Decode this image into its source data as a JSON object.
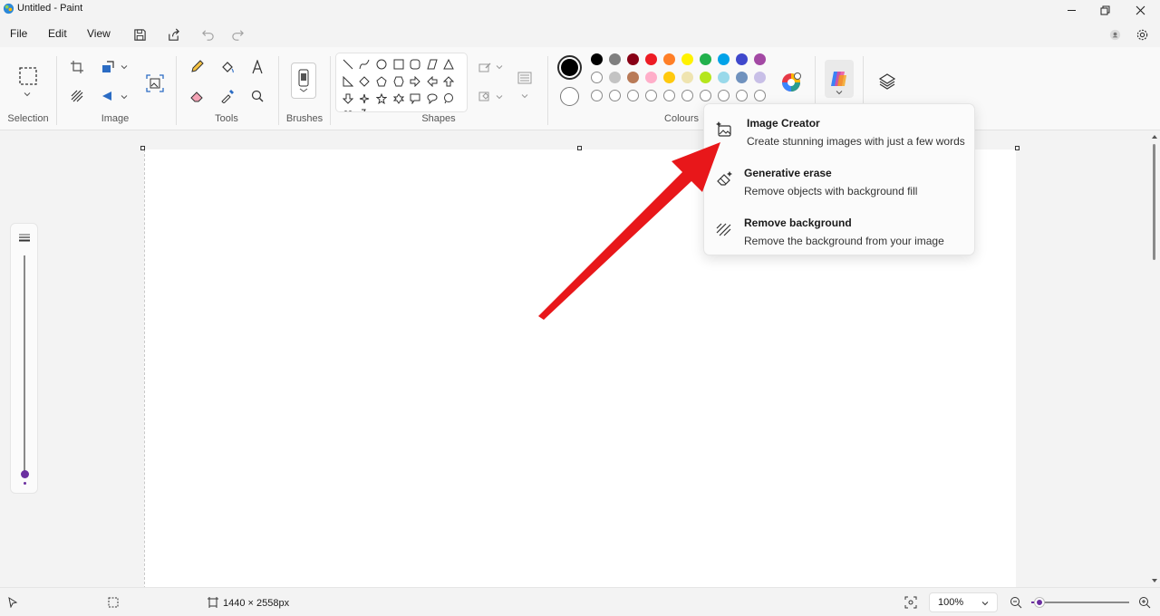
{
  "window": {
    "title": "Untitled - Paint"
  },
  "menu": {
    "file": "File",
    "edit": "Edit",
    "view": "View"
  },
  "ribbon": {
    "groups": {
      "selection": "Selection",
      "image": "Image",
      "tools": "Tools",
      "brushes": "Brushes",
      "shapes": "Shapes",
      "colours": "Colours"
    }
  },
  "palette": {
    "primary": "#000000",
    "secondary": "#ffffff",
    "row1": [
      "#000000",
      "#7f7f7f",
      "#880015",
      "#ed1c24",
      "#ff7f27",
      "#fff200",
      "#22b14c",
      "#00a2e8",
      "#3f48cc",
      "#a349a4"
    ],
    "row2": [
      "#ffffff",
      "#c3c3c3",
      "#b97a57",
      "#ffaec9",
      "#ffc90e",
      "#efe4b0",
      "#b5e61d",
      "#99d9ea",
      "#7092be",
      "#c8bfe7"
    ],
    "row3_empty_count": 10
  },
  "dropdown": {
    "items": [
      {
        "title": "Image Creator",
        "desc": "Create stunning images with just a few words",
        "icon": "image-sparkle-icon"
      },
      {
        "title": "Generative erase",
        "desc": "Remove objects with background fill",
        "icon": "eraser-sparkle-icon"
      },
      {
        "title": "Remove background",
        "desc": "Remove the background from your image",
        "icon": "remove-background-icon"
      }
    ]
  },
  "status": {
    "canvas_size": "1440 × 2558px",
    "zoom": "100%",
    "zoom_slider_fraction": 0.08
  },
  "annotation": {
    "arrow_color": "#e8171a"
  }
}
